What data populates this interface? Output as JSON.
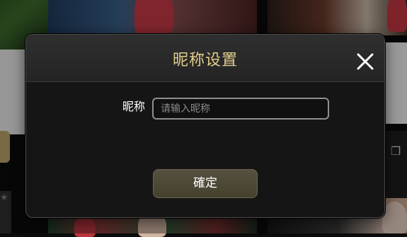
{
  "dialog": {
    "title": "昵称设置",
    "field_label": "昵称",
    "input_placeholder": "请输入昵称",
    "input_value": "",
    "confirm_label": "確定"
  },
  "icons": {
    "close": "close-x-icon",
    "dealer": "dealer-cards-icon",
    "favorite": "star-icon"
  },
  "colors": {
    "title": "#e2cf8c",
    "modal_bg": "#151515",
    "confirm_bg": "#4d4836"
  }
}
